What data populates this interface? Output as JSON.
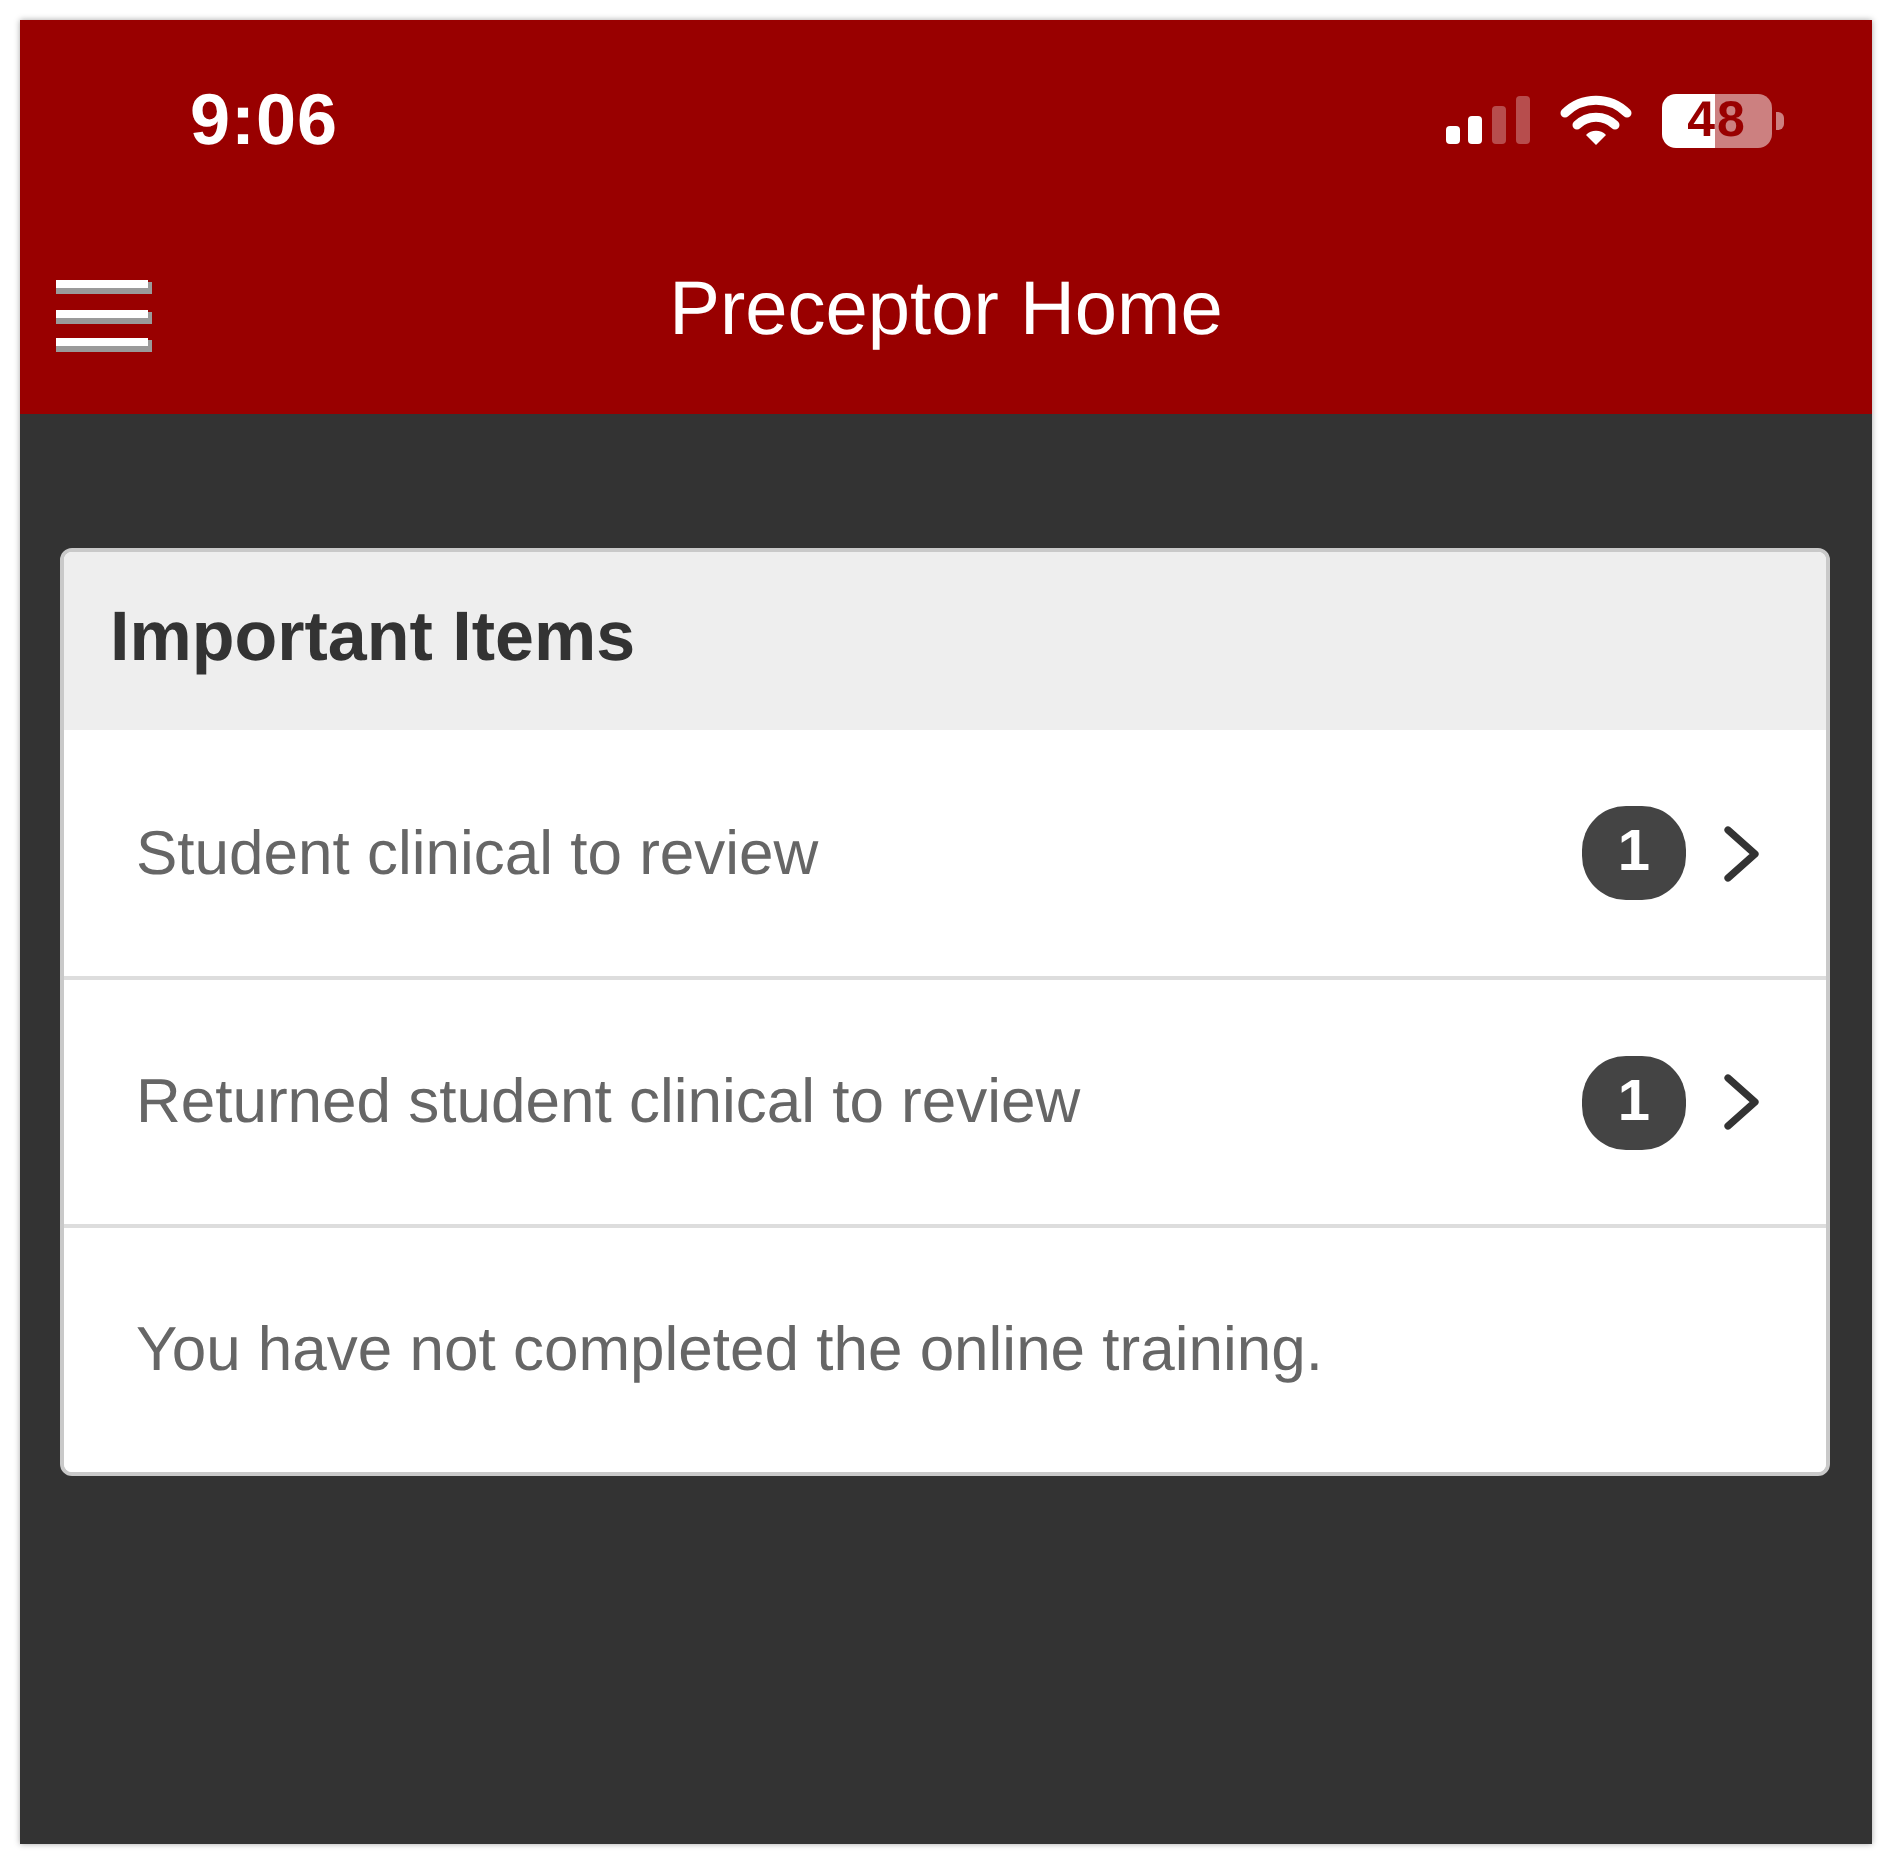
{
  "status_bar": {
    "time": "9:06",
    "battery": "48"
  },
  "nav_bar": {
    "title": "Preceptor Home"
  },
  "important_items": {
    "title": "Important Items",
    "items": [
      {
        "kind": "link",
        "label": "Student clinical to review",
        "count": "1"
      },
      {
        "kind": "link",
        "label": "Returned student clinical to review",
        "count": "1"
      },
      {
        "kind": "notice",
        "label": "You have not completed the online training."
      }
    ]
  }
}
